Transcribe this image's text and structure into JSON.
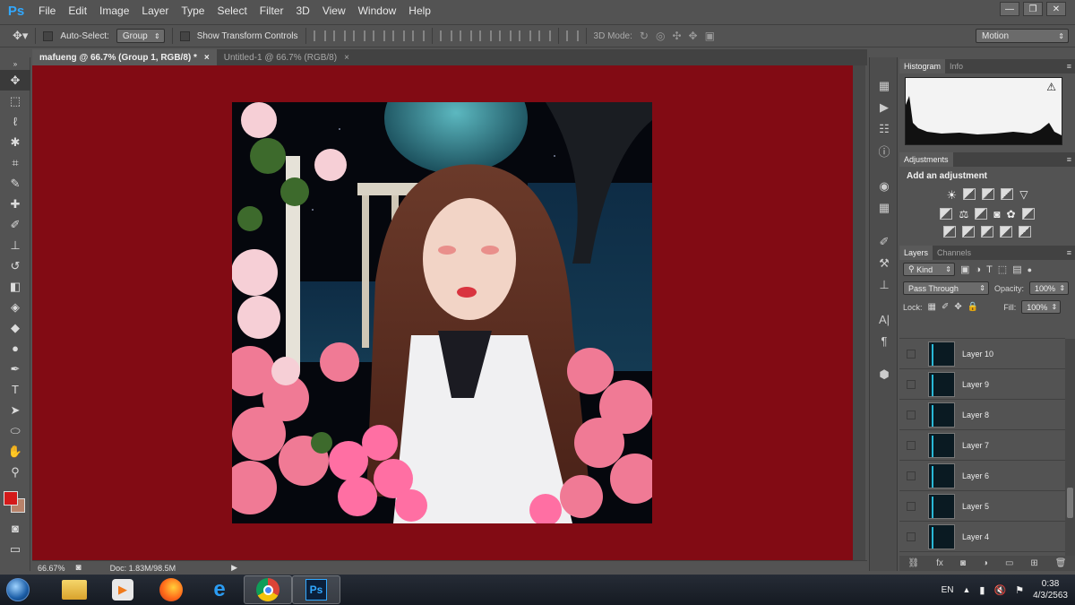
{
  "app": {
    "logo": "Ps"
  },
  "menu": [
    "File",
    "Edit",
    "Image",
    "Layer",
    "Type",
    "Select",
    "Filter",
    "3D",
    "View",
    "Window",
    "Help"
  ],
  "window_controls": {
    "minimize": "—",
    "restore": "❐",
    "close": "✕"
  },
  "options": {
    "auto_select_label": "Auto-Select:",
    "auto_select_value": "Group",
    "transform_label": "Show Transform Controls",
    "mode_3d_label": "3D Mode:",
    "workspace": "Motion"
  },
  "tabs": [
    {
      "label": "mafueng @ 66.7% (Group 1, RGB/8) *",
      "close": "×"
    },
    {
      "label": "Untitled-1 @ 66.7% (RGB/8)",
      "close": "×"
    }
  ],
  "status": {
    "zoom": "66.67%",
    "doc": "Doc: 1.83M/98.5M"
  },
  "panels": {
    "histogram_tab": "Histogram",
    "info_tab": "Info",
    "warning_icon": "⚠",
    "adjustments_tab": "Adjustments",
    "adjustments_title": "Add an adjustment",
    "layers_tab": "Layers",
    "channels_tab": "Channels",
    "kind_label": "Kind",
    "blend_mode": "Pass Through",
    "opacity_label": "Opacity:",
    "opacity_value": "100%",
    "lock_label": "Lock:",
    "fill_label": "Fill:",
    "fill_value": "100%",
    "layers": [
      "Layer 10",
      "Layer 9",
      "Layer 8",
      "Layer 7",
      "Layer 6",
      "Layer 5",
      "Layer 4"
    ]
  },
  "colors": {
    "canvas_bg": "#820b14",
    "foreground": "#d41a1a",
    "background": "#b8826a",
    "ps_blue": "#31a8ff"
  },
  "taskbar": {
    "apps": [
      "file-explorer",
      "media-player",
      "firefox",
      "internet-explorer",
      "chrome",
      "photoshop"
    ],
    "photoshop_label": "Ps",
    "language": "EN",
    "time": "0:38",
    "date": "4/3/2563"
  }
}
